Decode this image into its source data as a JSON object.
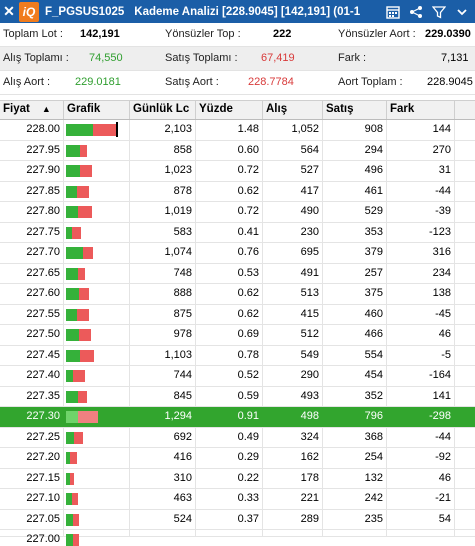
{
  "title": {
    "close": "✕",
    "logo": "iQ",
    "symbol": "F_PGSUS1025",
    "caption": "Kademe Analizi [228.9045] [142,191] (01-1"
  },
  "summary": {
    "toplam_lot_label": "Toplam Lot :",
    "toplam_lot": "142,191",
    "yonsuzler_top_label": "Yönsüzler Top :",
    "yonsuzler_top": "222",
    "yonsuzler_aort_label": "Yönsüzler Aort :",
    "yonsuzler_aort": "229.0390",
    "alis_toplami_label": "Alış Toplamı :",
    "alis_toplami": "74,550",
    "satis_toplami_label": "Satış Toplamı :",
    "satis_toplami": "67,419",
    "fark_label": "Fark :",
    "fark": "7,131",
    "alis_aort_label": "Alış Aort :",
    "alis_aort": "229.0181",
    "satis_aort_label": "Satış Aort :",
    "satis_aort": "228.7784",
    "aort_toplam_label": "Aort Toplam :",
    "aort_toplam": "228.9045"
  },
  "columns": [
    "Fiyat",
    "Grafik",
    "Günlük Lc",
    "Yüzde",
    "Alış",
    "Satış",
    "Fark"
  ],
  "sort_indicator": "▲",
  "rows": [
    {
      "fiyat": "228.00",
      "lot": "2,103",
      "yuzde": "1.48",
      "alis": "1,052",
      "satis": "908",
      "fark": "144",
      "g": 0.43,
      "r": 0.37,
      "mark": true
    },
    {
      "fiyat": "227.95",
      "lot": "858",
      "yuzde": "0.60",
      "alis": "564",
      "satis": "294",
      "fark": "270",
      "g": 0.23,
      "r": 0.12
    },
    {
      "fiyat": "227.90",
      "lot": "1,023",
      "yuzde": "0.72",
      "alis": "527",
      "satis": "496",
      "fark": "31",
      "g": 0.22,
      "r": 0.2
    },
    {
      "fiyat": "227.85",
      "lot": "878",
      "yuzde": "0.62",
      "alis": "417",
      "satis": "461",
      "fark": "-44",
      "g": 0.17,
      "r": 0.19
    },
    {
      "fiyat": "227.80",
      "lot": "1,019",
      "yuzde": "0.72",
      "alis": "490",
      "satis": "529",
      "fark": "-39",
      "g": 0.2,
      "r": 0.22
    },
    {
      "fiyat": "227.75",
      "lot": "583",
      "yuzde": "0.41",
      "alis": "230",
      "satis": "353",
      "fark": "-123",
      "g": 0.09,
      "r": 0.15
    },
    {
      "fiyat": "227.70",
      "lot": "1,074",
      "yuzde": "0.76",
      "alis": "695",
      "satis": "379",
      "fark": "316",
      "g": 0.28,
      "r": 0.16
    },
    {
      "fiyat": "227.65",
      "lot": "748",
      "yuzde": "0.53",
      "alis": "491",
      "satis": "257",
      "fark": "234",
      "g": 0.2,
      "r": 0.11
    },
    {
      "fiyat": "227.60",
      "lot": "888",
      "yuzde": "0.62",
      "alis": "513",
      "satis": "375",
      "fark": "138",
      "g": 0.21,
      "r": 0.16
    },
    {
      "fiyat": "227.55",
      "lot": "875",
      "yuzde": "0.62",
      "alis": "415",
      "satis": "460",
      "fark": "-45",
      "g": 0.17,
      "r": 0.19
    },
    {
      "fiyat": "227.50",
      "lot": "978",
      "yuzde": "0.69",
      "alis": "512",
      "satis": "466",
      "fark": "46",
      "g": 0.21,
      "r": 0.19
    },
    {
      "fiyat": "227.45",
      "lot": "1,103",
      "yuzde": "0.78",
      "alis": "549",
      "satis": "554",
      "fark": "-5",
      "g": 0.22,
      "r": 0.23
    },
    {
      "fiyat": "227.40",
      "lot": "744",
      "yuzde": "0.52",
      "alis": "290",
      "satis": "454",
      "fark": "-164",
      "g": 0.12,
      "r": 0.19
    },
    {
      "fiyat": "227.35",
      "lot": "845",
      "yuzde": "0.59",
      "alis": "493",
      "satis": "352",
      "fark": "141",
      "g": 0.2,
      "r": 0.15
    },
    {
      "fiyat": "227.30",
      "lot": "1,294",
      "yuzde": "0.91",
      "alis": "498",
      "satis": "796",
      "fark": "-298",
      "g": 0.2,
      "r": 0.33,
      "hl": true
    },
    {
      "fiyat": "227.25",
      "lot": "692",
      "yuzde": "0.49",
      "alis": "324",
      "satis": "368",
      "fark": "-44",
      "g": 0.13,
      "r": 0.15
    },
    {
      "fiyat": "227.20",
      "lot": "416",
      "yuzde": "0.29",
      "alis": "162",
      "satis": "254",
      "fark": "-92",
      "g": 0.07,
      "r": 0.11
    },
    {
      "fiyat": "227.15",
      "lot": "310",
      "yuzde": "0.22",
      "alis": "178",
      "satis": "132",
      "fark": "46",
      "g": 0.07,
      "r": 0.06
    },
    {
      "fiyat": "227.10",
      "lot": "463",
      "yuzde": "0.33",
      "alis": "221",
      "satis": "242",
      "fark": "-21",
      "g": 0.09,
      "r": 0.1
    },
    {
      "fiyat": "227.05",
      "lot": "524",
      "yuzde": "0.37",
      "alis": "289",
      "satis": "235",
      "fark": "54",
      "g": 0.12,
      "r": 0.1
    },
    {
      "fiyat": "227.00",
      "lot": "",
      "yuzde": "",
      "alis": "",
      "satis": "",
      "fark": "",
      "g": 0.12,
      "r": 0.1,
      "cut": true
    }
  ]
}
